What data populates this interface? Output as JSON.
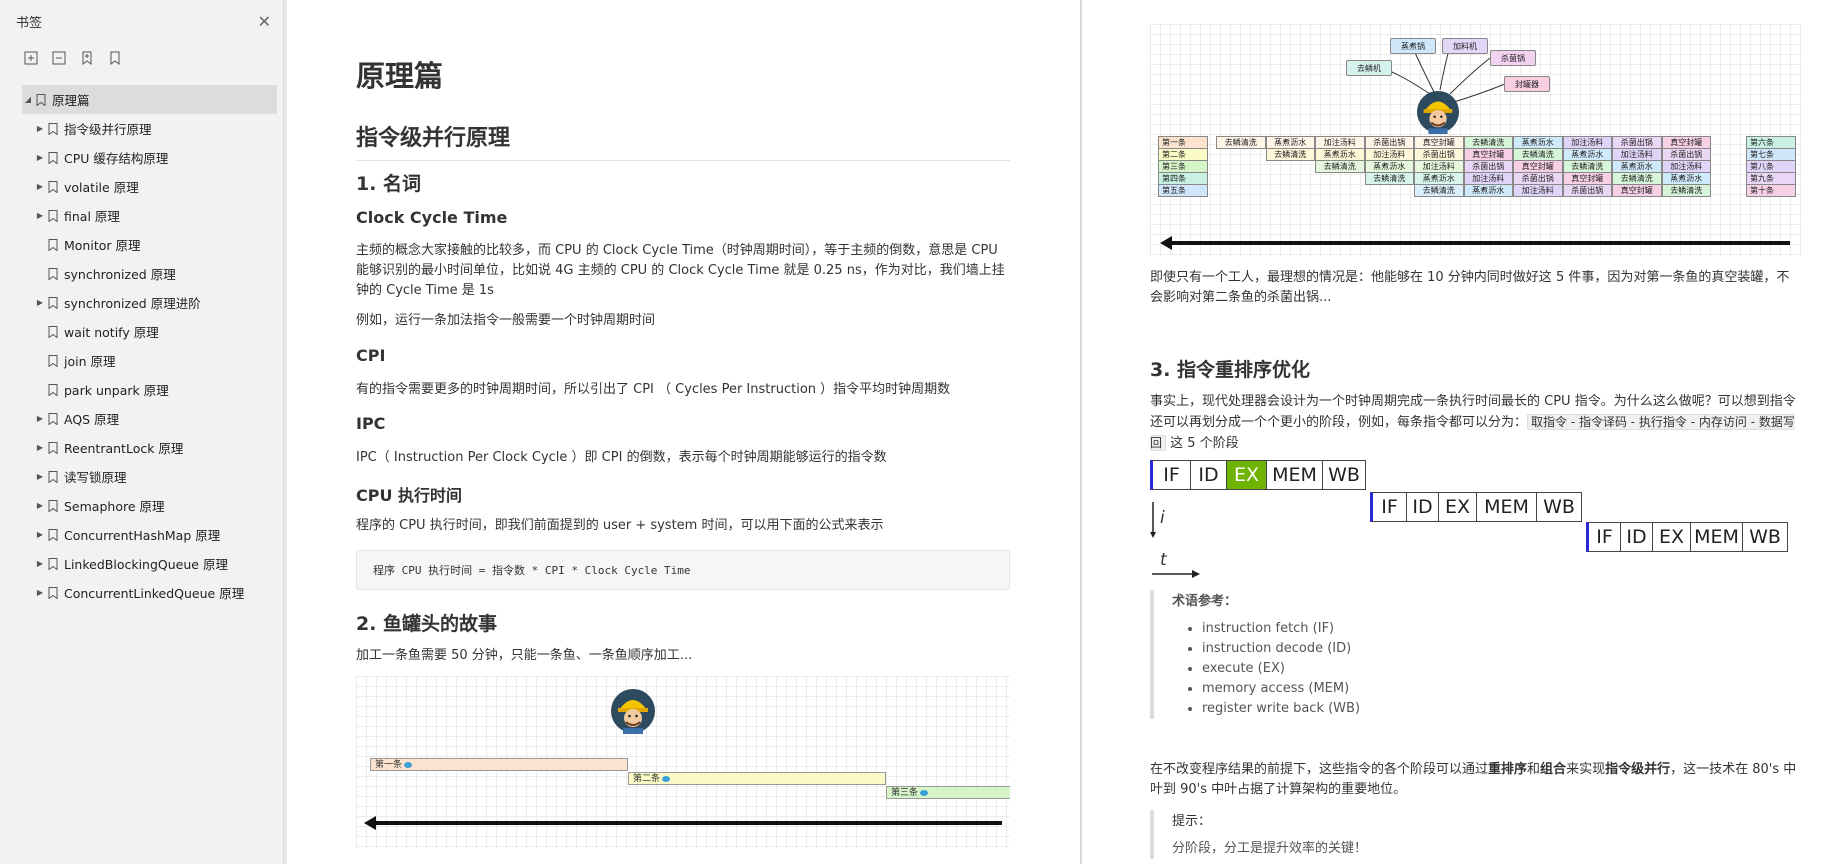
{
  "sidebar": {
    "title": "书签",
    "items": [
      {
        "label": "原理篇",
        "level": 0,
        "arrow": true,
        "expanded": true,
        "selected": true
      },
      {
        "label": "指令级并行原理",
        "level": 1,
        "arrow": true
      },
      {
        "label": "CPU 缓存结构原理",
        "level": 1,
        "arrow": true
      },
      {
        "label": "volatile 原理",
        "level": 1,
        "arrow": true
      },
      {
        "label": "final 原理",
        "level": 1,
        "arrow": true
      },
      {
        "label": "Monitor 原理",
        "level": 1,
        "arrow": false
      },
      {
        "label": "synchronized 原理",
        "level": 1,
        "arrow": false
      },
      {
        "label": "synchronized 原理进阶",
        "level": 1,
        "arrow": true
      },
      {
        "label": "wait notify 原理",
        "level": 1,
        "arrow": false
      },
      {
        "label": "join 原理",
        "level": 1,
        "arrow": false
      },
      {
        "label": "park unpark 原理",
        "level": 1,
        "arrow": false
      },
      {
        "label": "AQS 原理",
        "level": 1,
        "arrow": true
      },
      {
        "label": "ReentrantLock 原理",
        "level": 1,
        "arrow": true
      },
      {
        "label": "读写锁原理",
        "level": 1,
        "arrow": true
      },
      {
        "label": "Semaphore 原理",
        "level": 1,
        "arrow": true
      },
      {
        "label": "ConcurrentHashMap 原理",
        "level": 1,
        "arrow": true
      },
      {
        "label": "LinkedBlockingQueue 原理",
        "level": 1,
        "arrow": true
      },
      {
        "label": "ConcurrentLinkedQueue 原理",
        "level": 1,
        "arrow": true
      }
    ]
  },
  "left": {
    "h1": "原理篇",
    "h2": "指令级并行原理",
    "s1": "1. 名词",
    "cct_h": "Clock Cycle Time",
    "cct_p1": "主频的概念大家接触的比较多，而 CPU 的 Clock Cycle Time（时钟周期时间），等于主频的倒数，意思是 CPU 能够识别的最小时间单位，比如说 4G 主频的 CPU 的 Clock Cycle Time 就是 0.25 ns，作为对比，我们墙上挂钟的 Cycle Time 是 1s",
    "cct_p2": "例如，运行一条加法指令一般需要一个时钟周期时间",
    "cpi_h": "CPI",
    "cpi_p": "有的指令需要更多的时钟周期时间，所以引出了 CPI （ Cycles Per Instruction ）指令平均时钟周期数",
    "ipc_h": "IPC",
    "ipc_p": "IPC（ Instruction Per Clock Cycle ）即 CPI 的倒数，表示每个时钟周期能够运行的指令数",
    "cpu_h": "CPU 执行时间",
    "cpu_p": "程序的 CPU 执行时间，即我们前面提到的 user + system 时间，可以用下面的公式来表示",
    "code": "程序 CPU 执行时间 = 指令数 * CPI * Clock Cycle Time",
    "s2": "2. 鱼罐头的故事",
    "s2_p": "加工一条鱼需要 50 分钟，只能一条鱼、一条鱼顺序加工...",
    "fish_labels": [
      "第一条",
      "第二条",
      "第三条"
    ]
  },
  "right": {
    "tools": [
      "去鳞机",
      "蒸煮锅",
      "加料机",
      "杀菌锅",
      "封罐器"
    ],
    "rows": [
      "第一条",
      "第二条",
      "第三条",
      "第四条",
      "第五条"
    ],
    "rows_right": [
      "第六条",
      "第七条",
      "第八条",
      "第九条",
      "第十条"
    ],
    "steps": [
      "去鳞清洗",
      "蒸煮沥水",
      "加注汤料",
      "杀菌出锅",
      "真空封罐"
    ],
    "para1": "即使只有一个工人，最理想的情况是：他能够在 10 分钟内同时做好这 5 件事，因为对第一条鱼的真空装罐，不会影响对第二条鱼的杀菌出锅...",
    "s3": "3. 指令重排序优化",
    "para2a": "事实上，现代处理器会设计为一个时钟周期完成一条执行时间最长的 CPU 指令。为什么这么做呢？可以想到指令还可以再划分成一个个更小的阶段，例如，每条指令都可以分为：",
    "para2code": "取指令 - 指令译码 - 执行指令 - 内存访问 - 数据写回",
    "para2b": "这 5 个阶段",
    "stages": [
      "IF",
      "ID",
      "EX",
      "MEM",
      "WB"
    ],
    "axis_i": "i",
    "axis_t": "t",
    "bq_title": "术语参考：",
    "bq_items": [
      "instruction fetch (IF)",
      "instruction decode (ID)",
      "execute (EX)",
      "memory access (MEM)",
      "register write back (WB)"
    ],
    "para3_pre": "在不改变程序结果的前提下，这些指令的各个阶段可以通过",
    "para3_b1": "重排序",
    "para3_and": "和",
    "para3_b2": "组合",
    "para3_mid": "来实现",
    "para3_b3": "指令级并行",
    "para3_post": "，这一技术在 80's 中叶到 90's 中叶占据了计算架构的重要地位。",
    "tip_title": "提示：",
    "tip_text": "分阶段，分工是提升效率的关键！"
  }
}
